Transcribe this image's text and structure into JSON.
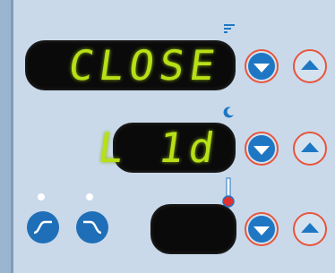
{
  "displays": {
    "main": {
      "text": "CLOSE"
    },
    "secondary": {
      "text": "L 1d"
    },
    "third": {
      "text": ""
    }
  },
  "indicators": {
    "row1": "fan-icon",
    "row2": "moon-icon",
    "row3": "thermometer-icon"
  },
  "buttons": {
    "down_label": "▼",
    "up_label": "▲",
    "left1": "ramp-up-icon",
    "left2": "ramp-down-icon"
  },
  "colors": {
    "display_text": "#b8e017",
    "button_blue": "#1f77c4",
    "button_ring": "#e8553a"
  }
}
